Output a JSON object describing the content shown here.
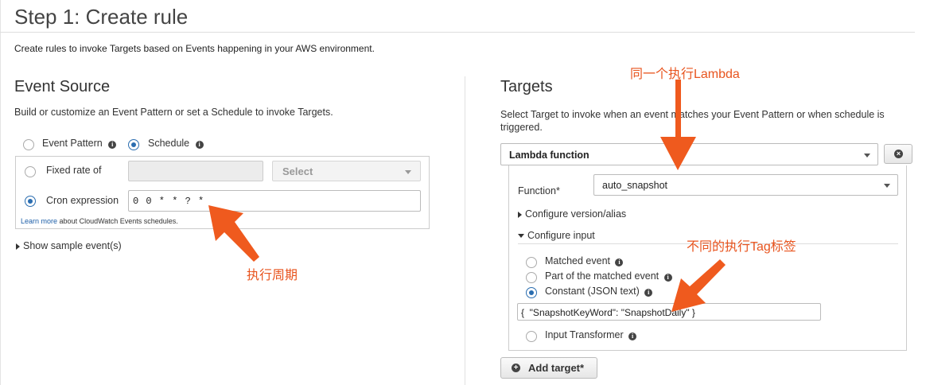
{
  "page": {
    "title": "Step 1: Create rule",
    "description": "Create rules to invoke Targets based on Events happening in your AWS environment."
  },
  "event_source": {
    "heading": "Event Source",
    "description": "Build or customize an Event Pattern or set a Schedule to invoke Targets.",
    "option_event_pattern": "Event Pattern",
    "option_schedule": "Schedule",
    "selected": "Schedule",
    "fixed_rate_label": "Fixed rate of",
    "fixed_rate_value": "",
    "unit_select_label": "Select",
    "cron_label": "Cron expression",
    "cron_value": "0 0 * * ? *",
    "learn_more_link": "Learn more",
    "learn_more_text": "about CloudWatch Events schedules.",
    "show_sample": "Show sample event(s)"
  },
  "targets": {
    "heading": "Targets",
    "description": "Select Target to invoke when an event matches your Event Pattern or when schedule is triggered.",
    "target_type": "Lambda function",
    "function_label": "Function*",
    "function_value": "auto_snapshot",
    "configure_version": "Configure version/alias",
    "configure_input": "Configure input",
    "input_options": {
      "matched_event": "Matched event",
      "part_matched": "Part of the matched event",
      "constant": "Constant (JSON text)",
      "transformer": "Input Transformer"
    },
    "selected_input": "Constant (JSON text)",
    "json_value": "{  \"SnapshotKeyWord\": \"SnapshotDaily\" }",
    "add_target": "Add target*"
  },
  "annotations": {
    "same_lambda": "同一个执行Lambda",
    "cron_period": "执行周期",
    "different_tag": "不同的执行Tag标签"
  },
  "colors": {
    "accent_blue": "#2a6db0",
    "annotation_orange": "#e8541e"
  },
  "icons": [
    "info-icon",
    "caret-down-icon",
    "remove-icon",
    "plus-icon",
    "expand-right-icon",
    "collapse-down-icon",
    "arrow-annotation-icon"
  ]
}
